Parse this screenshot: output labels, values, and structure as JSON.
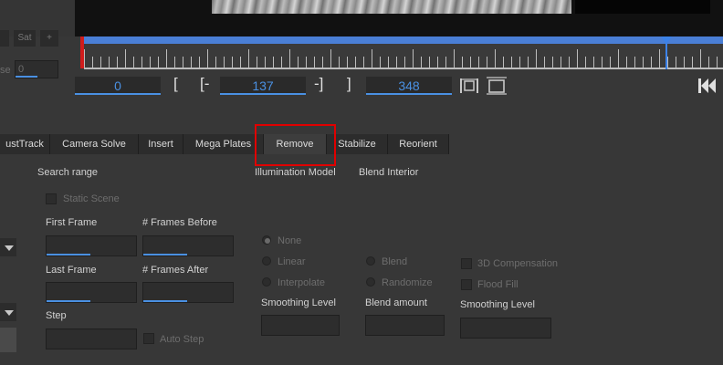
{
  "toolbar": {
    "btn_left": "",
    "btn_sat": "Sat",
    "btn_plus": "+",
    "sideways_label": "se",
    "sideways_value": "0"
  },
  "timeline": {
    "start_frame": "0",
    "in_frame": "137",
    "out_frame": "348",
    "bracket_open": "[",
    "in_open": "[-",
    "in_close": "-]",
    "bracket_close": "]"
  },
  "tabs": [
    {
      "label": "ustTrack",
      "active": false
    },
    {
      "label": "Camera Solve",
      "active": false
    },
    {
      "label": "Insert",
      "active": false
    },
    {
      "label": "Mega Plates",
      "active": false
    },
    {
      "label": "Remove",
      "active": true
    },
    {
      "label": "Stabilize",
      "active": false
    },
    {
      "label": "Reorient",
      "active": false
    }
  ],
  "search": {
    "title": "Search range",
    "static_scene": "Static Scene",
    "first_frame": "First Frame",
    "frames_before": "# Frames Before",
    "last_frame": "Last Frame",
    "frames_after": "# Frames After",
    "step": "Step",
    "auto_step": "Auto Step"
  },
  "illumination": {
    "title": "Illumination Model",
    "none": "None",
    "linear": "Linear",
    "interpolate": "Interpolate",
    "smoothing_level": "Smoothing Level"
  },
  "blend": {
    "title": "Blend Interior",
    "blend": "Blend",
    "randomize": "Randomize",
    "blend_amount": "Blend amount"
  },
  "extra": {
    "compensation_3d": "3D Compensation",
    "flood_fill": "Flood Fill",
    "smoothing_level": "Smoothing Level"
  },
  "colors": {
    "accent": "#4a90e2",
    "highlight": "#e00000",
    "in_marker": "#d01c1c"
  }
}
